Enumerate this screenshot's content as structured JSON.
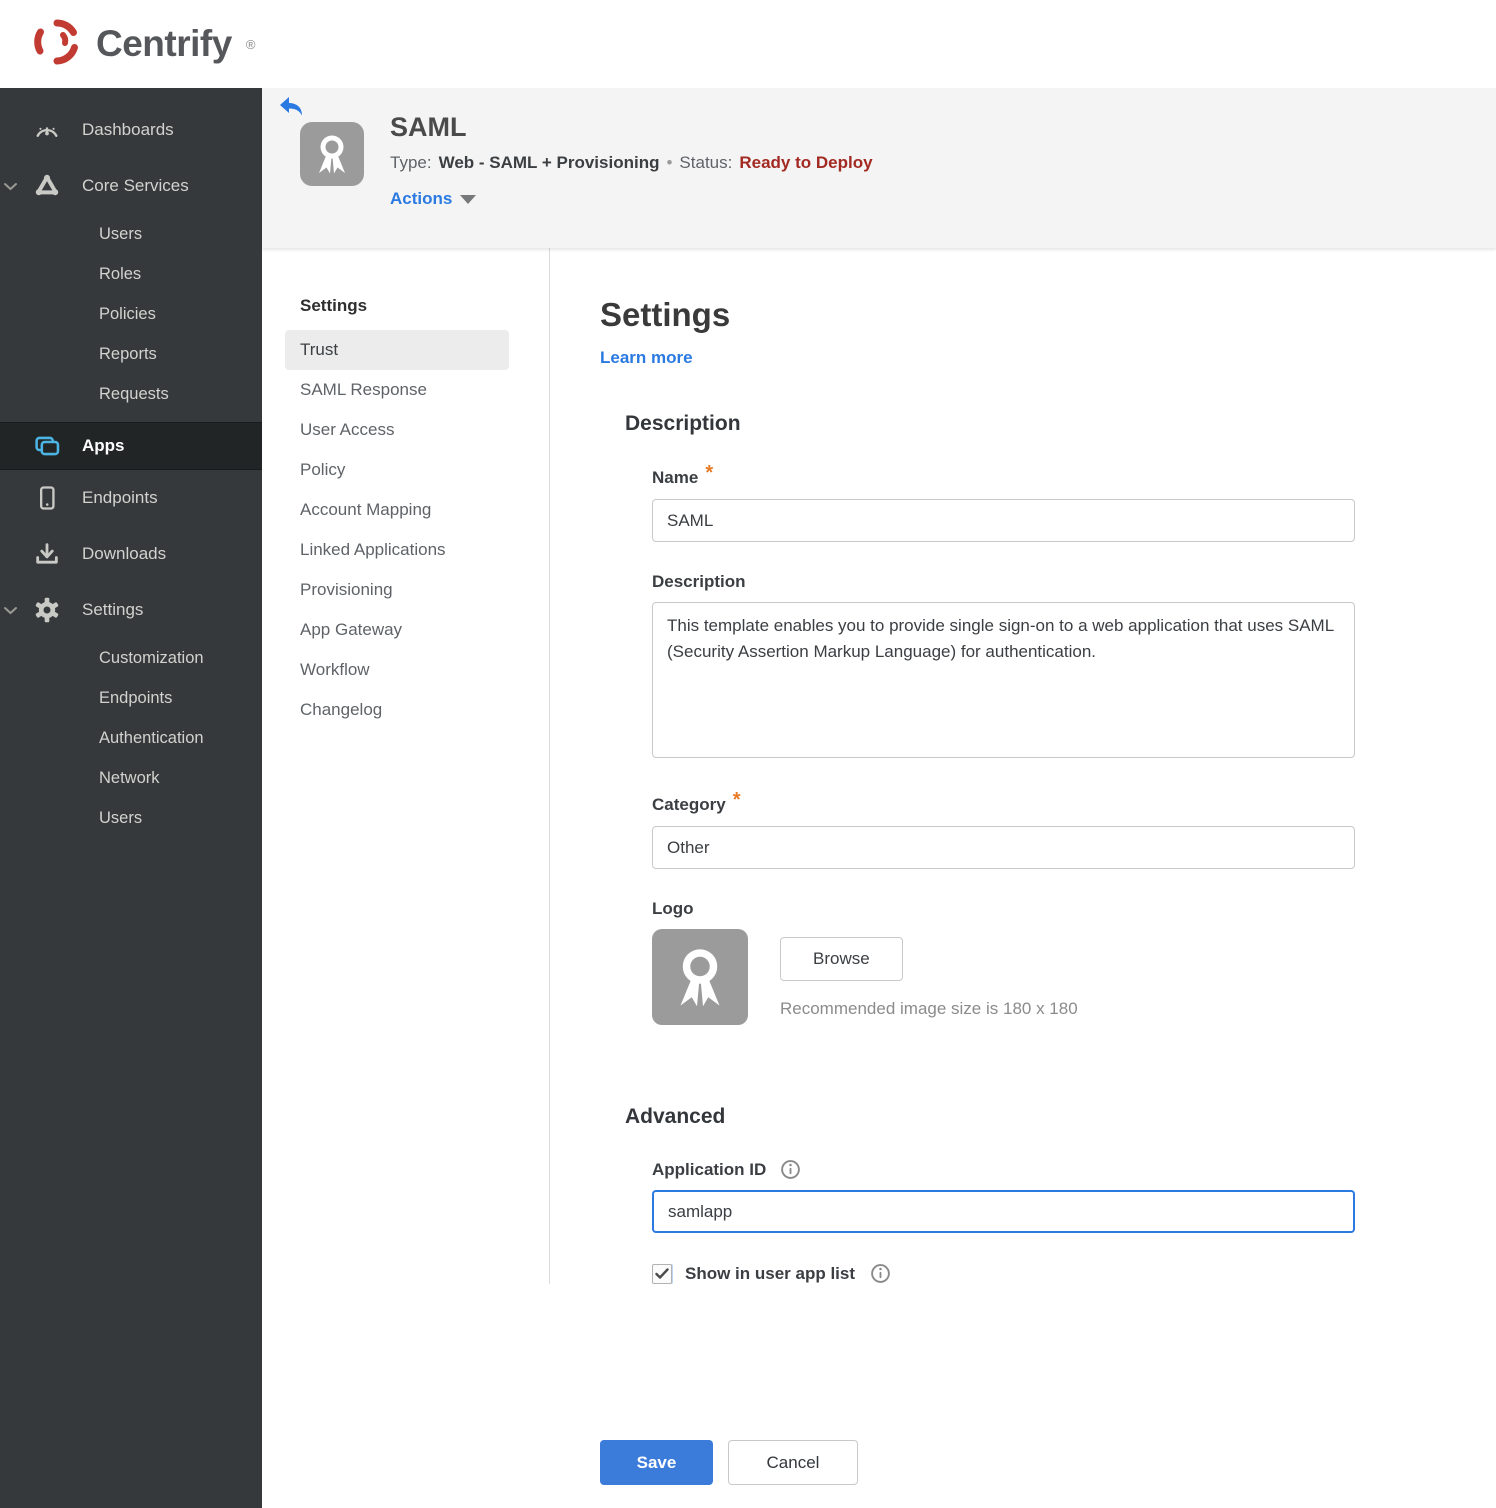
{
  "brand": {
    "name": "Centrify",
    "reg_mark": "®",
    "logo_color": "#c23b33"
  },
  "sidebar": {
    "items": [
      {
        "label": "Dashboards",
        "icon": "gauge-icon"
      },
      {
        "label": "Core Services",
        "icon": "core-services-icon",
        "expanded": true,
        "children": [
          "Users",
          "Roles",
          "Policies",
          "Reports",
          "Requests"
        ]
      },
      {
        "label": "Apps",
        "icon": "apps-icon",
        "active": true
      },
      {
        "label": "Endpoints",
        "icon": "phone-icon"
      },
      {
        "label": "Downloads",
        "icon": "download-icon"
      },
      {
        "label": "Settings",
        "icon": "gear-icon",
        "expanded": true,
        "children": [
          "Customization",
          "Endpoints",
          "Authentication",
          "Network",
          "Users"
        ]
      }
    ]
  },
  "header": {
    "app_title": "SAML",
    "type_label": "Type:",
    "type_value": "Web - SAML + Provisioning",
    "separator": "•",
    "status_label": "Status:",
    "status_value": "Ready to Deploy",
    "actions_label": "Actions"
  },
  "subnav": {
    "heading": "Settings",
    "selected": "Trust",
    "items": [
      "Trust",
      "SAML Response",
      "User Access",
      "Policy",
      "Account Mapping",
      "Linked Applications",
      "Provisioning",
      "App Gateway",
      "Workflow",
      "Changelog"
    ]
  },
  "main": {
    "title": "Settings",
    "learn_more": "Learn more",
    "description_section": {
      "heading": "Description",
      "name_label": "Name",
      "name_value": "SAML",
      "description_label": "Description",
      "description_value": "This template enables you to provide single sign-on to a web application that uses SAML (Security Assertion Markup Language) for authentication.",
      "category_label": "Category",
      "category_value": "Other",
      "logo_label": "Logo",
      "browse_label": "Browse",
      "logo_hint": "Recommended image size is 180 x 180"
    },
    "advanced_section": {
      "heading": "Advanced",
      "app_id_label": "Application ID",
      "app_id_value": "samlapp",
      "show_in_app_list_label": "Show in user app list",
      "show_in_app_list_checked": true
    },
    "footer": {
      "save_label": "Save",
      "cancel_label": "Cancel"
    }
  },
  "colors": {
    "accent_blue": "#2a7ae2",
    "save_blue": "#3b7cdb",
    "status_red": "#a32a23",
    "asterisk_orange": "#e87a24",
    "apps_icon_blue": "#4db5e6",
    "sidebar_bg": "#35393b",
    "header_bg": "#f4f4f4"
  }
}
